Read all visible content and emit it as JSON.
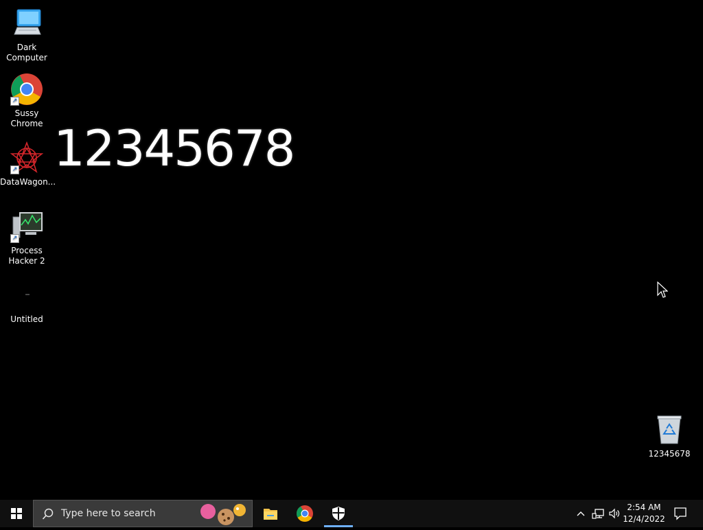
{
  "desktop": {
    "icons": [
      {
        "label": "Dark\nComputer",
        "icon": "computer-icon"
      },
      {
        "label": "Sussy\nChrome",
        "icon": "chrome-icon"
      },
      {
        "label": "DataWagon...",
        "icon": "datawagon-icon"
      },
      {
        "label": "Process\nHacker 2",
        "icon": "process-hacker-icon"
      },
      {
        "label": "Untitled",
        "icon": "blank-file-icon"
      }
    ],
    "recycle_bin_label": "12345678",
    "wallpaper_text": "12345678"
  },
  "taskbar": {
    "search_placeholder": "Type here to search",
    "pinned": [
      "file-explorer-icon",
      "chrome-icon",
      "security-shield-icon"
    ],
    "clock": {
      "time": "2:54 AM",
      "date": "12/4/2022"
    }
  },
  "colors": {
    "background": "#000000",
    "taskbar": "#101010",
    "accent": "#6fb1ff"
  }
}
